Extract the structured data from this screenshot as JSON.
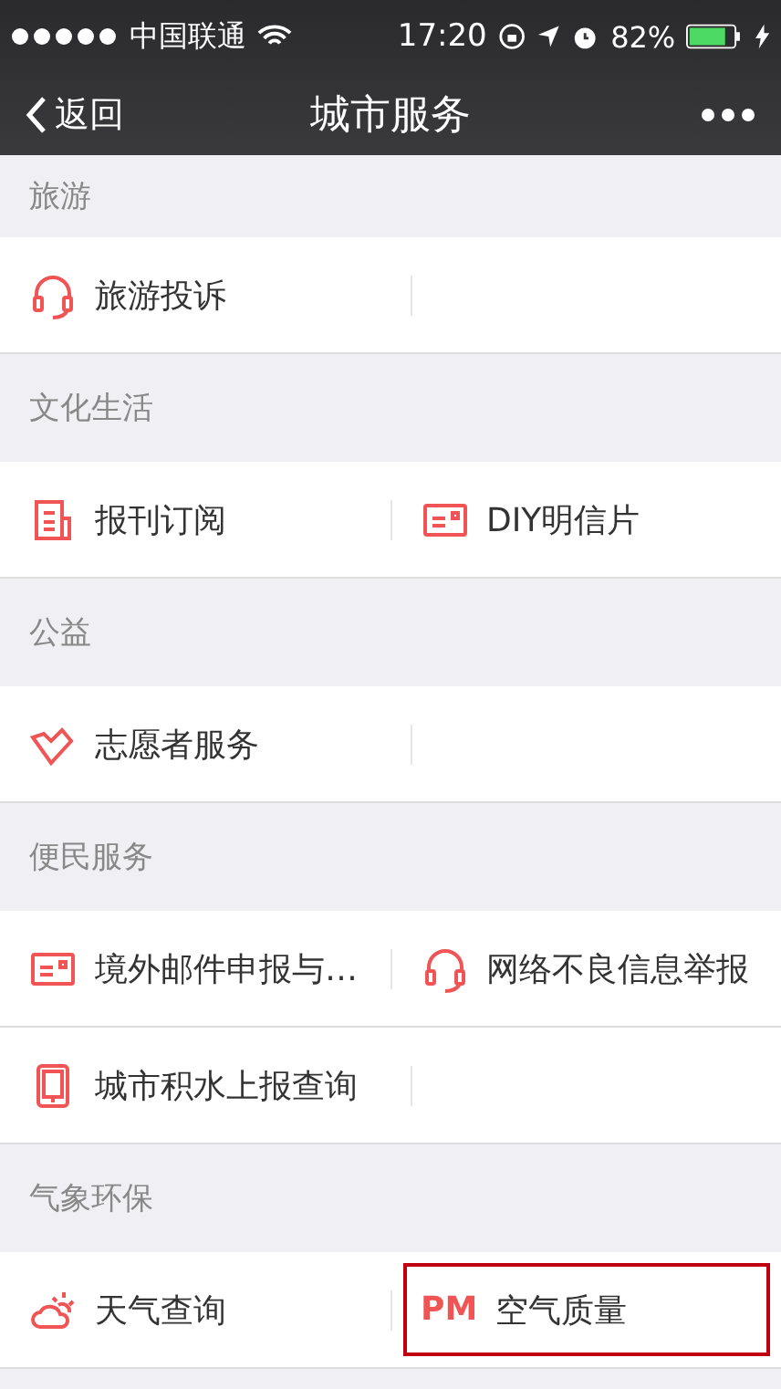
{
  "status_bar": {
    "carrier": "中国联通",
    "time": "17:20",
    "battery": "82%"
  },
  "nav": {
    "back": "返回",
    "title": "城市服务"
  },
  "sections": [
    {
      "title": "旅游",
      "rows": [
        [
          {
            "kind": "headset",
            "label": "旅游投诉",
            "highlighted": false
          }
        ]
      ]
    },
    {
      "title": "文化生活",
      "rows": [
        [
          {
            "kind": "newspaper",
            "label": "报刊订阅",
            "highlighted": false
          },
          {
            "kind": "card",
            "label": "DIY明信片",
            "highlighted": false
          }
        ]
      ]
    },
    {
      "title": "公益",
      "rows": [
        [
          {
            "kind": "heart",
            "label": "志愿者服务",
            "highlighted": false
          }
        ]
      ]
    },
    {
      "title": "便民服务",
      "rows": [
        [
          {
            "kind": "card",
            "label": "境外邮件申报与…",
            "highlighted": false
          },
          {
            "kind": "headset",
            "label": "网络不良信息举报",
            "highlighted": false
          }
        ],
        [
          {
            "kind": "tablet",
            "label": "城市积水上报查询",
            "highlighted": false
          }
        ]
      ]
    },
    {
      "title": "气象环保",
      "rows": [
        [
          {
            "kind": "weather",
            "label": "天气查询",
            "highlighted": false
          },
          {
            "kind": "text",
            "icon_text": "PM",
            "label": "空气质量",
            "highlighted": true
          }
        ]
      ]
    }
  ]
}
